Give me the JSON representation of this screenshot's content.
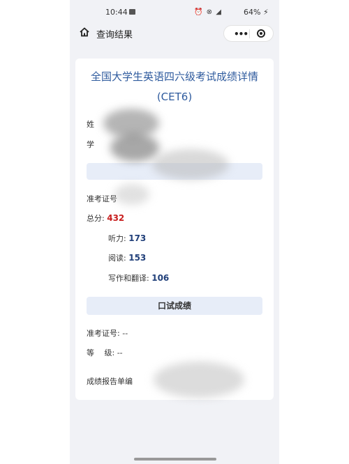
{
  "status_bar": {
    "time": "10:44",
    "icons": "⏰ ⊗ ◢",
    "battery": "64% ⚡"
  },
  "nav": {
    "title": "查询结果",
    "more_icon": "•••",
    "home_icon": "home-icon",
    "close_icon": "close-circle-icon"
  },
  "card": {
    "title_line1": "全国大学生英语四六级考试成绩详情",
    "title_line2": "(CET6)",
    "name_label": "姓",
    "school_label": "学",
    "exam_id_label": "准考证号",
    "total_label": "总分:",
    "total_value": "432",
    "listening_label": "听力:",
    "listening_value": "173",
    "reading_label": "阅读:",
    "reading_value": "153",
    "writing_label": "写作和翻译:",
    "writing_value": "106",
    "oral_section_title": "口试成绩",
    "oral_exam_id_label": "准考证号:",
    "oral_exam_id_value": "--",
    "grade_label": "等　 级:",
    "grade_value": "--",
    "report_label": "成绩报告单编"
  },
  "colors": {
    "title_blue": "#2f5b9e",
    "score_red": "#c81e1e",
    "score_blue": "#21407a",
    "bar_bg": "#e7edf8"
  }
}
